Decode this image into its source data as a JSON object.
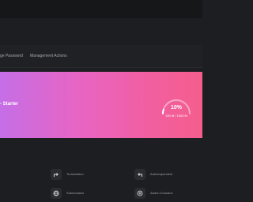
{
  "tabs": [
    "ge Password",
    "Management Actions"
  ],
  "hero": {
    "title": "- Starter",
    "usage_percent": "10%",
    "usage_text": "100 M / 1000 M",
    "usage_fraction": 0.1
  },
  "actions": [
    {
      "label": "",
      "icon": "unknown-icon"
    },
    {
      "label": "",
      "icon": "unknown-icon"
    },
    {
      "label": "Turnaxdisco",
      "icon": "redirect-icon"
    },
    {
      "label": "Subdomains",
      "icon": "globe-icon"
    },
    {
      "label": "Autoresponders",
      "icon": "reply-icon"
    },
    {
      "label": "Addon Domains",
      "icon": "add-circle-icon"
    }
  ],
  "colors": {
    "gradient_start": "#c56ee6",
    "gradient_end": "#f45e8c",
    "page_bg": "#1d1e21"
  }
}
